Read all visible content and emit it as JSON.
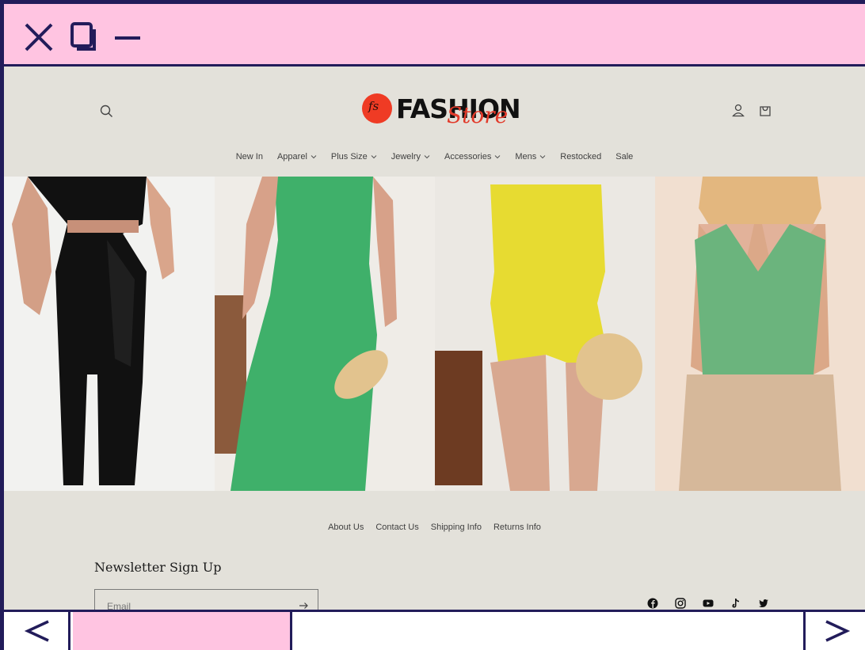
{
  "window": {
    "controls": [
      "close-icon",
      "restore-icon",
      "minimize-icon"
    ],
    "frame_color": "#221c5a",
    "bar_color": "#ffc4e1"
  },
  "store": {
    "logo": {
      "monogram": "fs",
      "word": "FASHION",
      "script": "Store"
    },
    "header_icons": [
      "search-icon",
      "account-icon",
      "cart-icon"
    ],
    "nav": [
      {
        "label": "New In",
        "dropdown": false
      },
      {
        "label": "Apparel",
        "dropdown": true
      },
      {
        "label": "Plus Size",
        "dropdown": true
      },
      {
        "label": "Jewelry",
        "dropdown": true
      },
      {
        "label": "Accessories",
        "dropdown": true
      },
      {
        "label": "Mens",
        "dropdown": true
      },
      {
        "label": "Restocked",
        "dropdown": false
      },
      {
        "label": "Sale",
        "dropdown": false
      }
    ],
    "gallery": [
      {
        "name": "black-halter-outfit-photo"
      },
      {
        "name": "green-maxi-dress-photo"
      },
      {
        "name": "yellow-romper-photo"
      },
      {
        "name": "green-crop-top-photo"
      }
    ],
    "footer_links": [
      "About Us",
      "Contact Us",
      "Shipping Info",
      "Returns Info"
    ],
    "newsletter": {
      "title": "Newsletter Sign Up",
      "placeholder": "Email"
    },
    "socials": [
      "facebook-icon",
      "instagram-icon",
      "youtube-icon",
      "tiktok-icon",
      "twitter-icon"
    ],
    "background": "#e3e1da"
  },
  "pager": {
    "progress": 0.3,
    "prev_symbol": "<",
    "next_symbol": ">"
  }
}
